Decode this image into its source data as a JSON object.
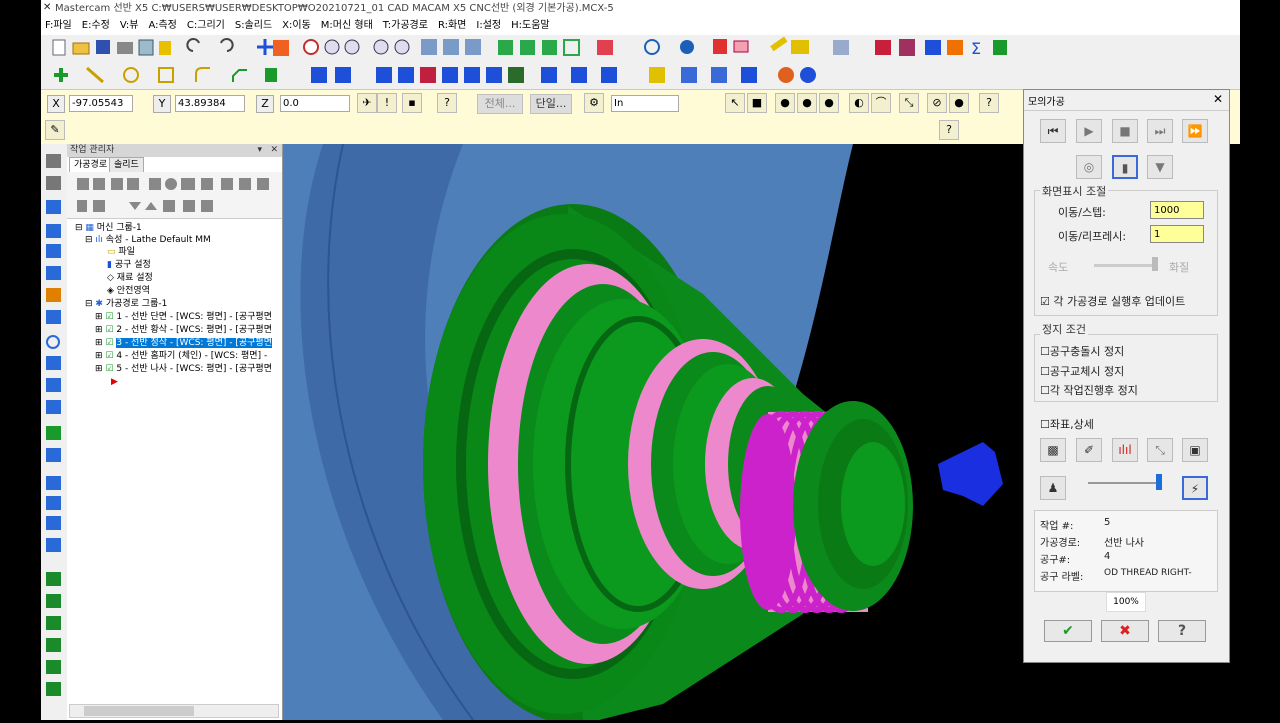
{
  "window": {
    "title": "Mastercam 선반 X5   C:₩USERS₩USER₩DESKTOP₩O20210721_01 CAD MACAM X5 CNC선반 (외경 기본가공).MCX-5"
  },
  "menu": [
    "F:파일",
    "E:수정",
    "V:뷰",
    "A:측정",
    "C:그리기",
    "S:솔리드",
    "X:이동",
    "M:머신 형태",
    "T:가공경로",
    "R:화면",
    "I:설정",
    "H:도움말"
  ],
  "coords": {
    "x_label": "X",
    "x_value": "-97.05543",
    "y_label": "Y",
    "y_value": "43.89384",
    "z_label": "Z",
    "z_value": "0.0",
    "btn_all": "전체...",
    "btn_single": "단일...",
    "unit": "In"
  },
  "op_manager": {
    "header": "작업 관리자",
    "tabs": [
      "가공경로",
      "솔리드"
    ],
    "tree": [
      {
        "label": "머신 그룹-1"
      },
      {
        "label": "속성 - Lathe Default MM"
      },
      {
        "label": "파일"
      },
      {
        "label": "공구 설정"
      },
      {
        "label": "재료 설정"
      },
      {
        "label": "안전영역"
      },
      {
        "label": "가공경로 그룹-1"
      },
      {
        "label": "1 - 선반 단면 - [WCS: 평면] - [공구평면"
      },
      {
        "label": "2 - 선반 황삭 - [WCS: 평면] - [공구평면"
      },
      {
        "label": "3 - 선반 정삭 - [WCS: 평면] - [공구평면"
      },
      {
        "label": "4 - 선반 홈파기 (체인) - [WCS: 평면] -"
      },
      {
        "label": "5 - 선반 나사 - [WCS: 평면] - [공구평면"
      }
    ]
  },
  "sim_dialog": {
    "title": "모의가공",
    "display_group": "화면표시 조절",
    "move_step_label": "이동/스텝:",
    "move_step_value": "1000",
    "move_refresh_label": "이동/리프레시:",
    "move_refresh_value": "1",
    "speed_label": "속도",
    "quality_label": "화질",
    "update_each": "각 가공경로 실행후 업데이트",
    "stop_group": "정지 조건",
    "stop_collision": "공구충돌시 정지",
    "stop_toolchange": "공구교체시 정지",
    "stop_each": "각 작업진행후 정지",
    "coords_detail": "좌표,상세",
    "info": {
      "op_label": "작업 #:",
      "op_value": "5",
      "path_label": "가공경로:",
      "path_value": "선반 나사",
      "tool_label": "공구#:",
      "tool_value": "4",
      "toollabel_label": "공구 라벨:",
      "toollabel_value": "OD THREAD RIGHT-"
    },
    "progress": "100%",
    "update_checked": true
  },
  "colors": {
    "part_green": "#0a8a1a",
    "part_pink": "#ee88cc",
    "thread_magenta": "#cc22cc",
    "chuck_blue": "#4f7fb8",
    "tool_blue": "#1a2fe0"
  }
}
